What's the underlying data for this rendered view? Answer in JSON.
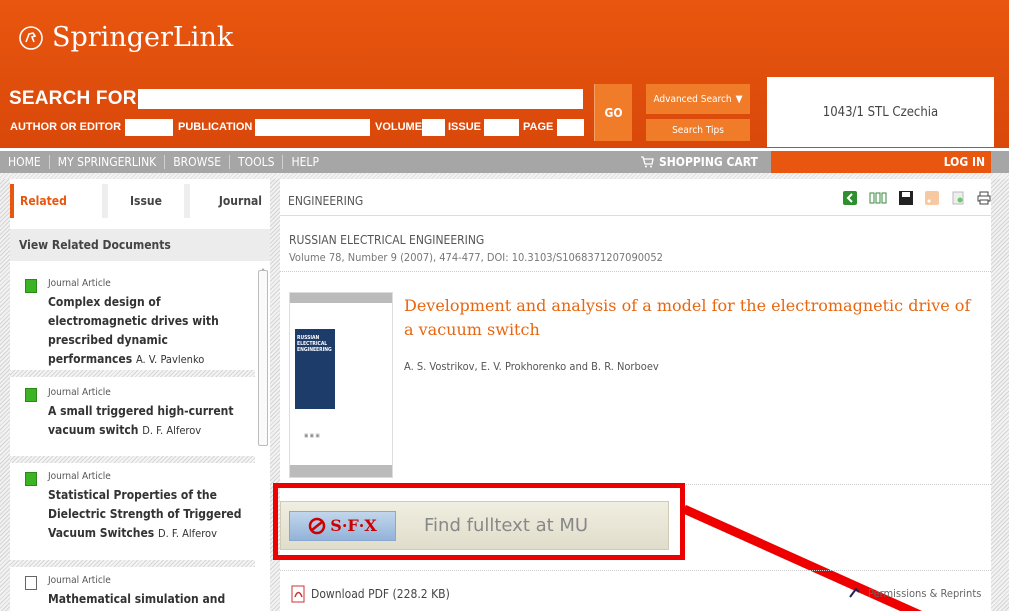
{
  "header": {
    "brand": "SpringerLink",
    "search_label": "SEARCH FOR",
    "fields": {
      "author": "AUTHOR OR EDITOR",
      "publication": "PUBLICATION",
      "volume": "VOLUME",
      "issue": "ISSUE",
      "page": "PAGE"
    },
    "go": "GO",
    "advanced": "Advanced Search",
    "tips": "Search Tips",
    "institution": "1043/1 STL Czechia"
  },
  "nav": {
    "items": [
      "HOME",
      "MY SPRINGERLINK",
      "BROWSE",
      "TOOLS",
      "HELP"
    ],
    "cart": "SHOPPING CART",
    "login": "LOG IN"
  },
  "sidebar": {
    "tabs": [
      "Related",
      "Issue",
      "Journal"
    ],
    "header": "View Related Documents",
    "docs": [
      {
        "type": "Journal Article",
        "title": "Complex design of electromagnetic drives with prescribed dynamic performances",
        "author": "A. V. Pavlenko"
      },
      {
        "type": "Journal Article",
        "title": "A small triggered high-current vacuum switch",
        "author": "D. F. Alferov"
      },
      {
        "type": "Journal Article",
        "title": "Statistical Properties of the Dielectric Strength of Triggered Vacuum Switches",
        "author": "D. F. Alferov"
      },
      {
        "type": "Journal Article",
        "title": "Mathematical simulation and",
        "author": ""
      }
    ]
  },
  "main": {
    "breadcrumb": "ENGINEERING",
    "journal": "RUSSIAN ELECTRICAL ENGINEERING",
    "volume": "Volume 78, Number 9 (2007), 474-477, DOI: 10.3103/S1068371207090052",
    "title": "Development and analysis of a model for the electromagnetic drive of a vacuum switch",
    "authors": "A. S. Vostrikov, E. V. Prokhorenko and B. R. Norboev",
    "cover_text": "RUSSIAN ELECTRICAL ENGINEERING",
    "sfx_logo": "S·F·X",
    "sfx_text": "Find fulltext at MU",
    "pdf": "Download PDF (228.2 KB)",
    "permissions": "Permissions & Reprints"
  },
  "colors": {
    "brand_orange": "#e8560f",
    "title_orange": "#e8660f",
    "nav_gray": "#a6a6a6",
    "annotation_red": "#ee0000"
  }
}
